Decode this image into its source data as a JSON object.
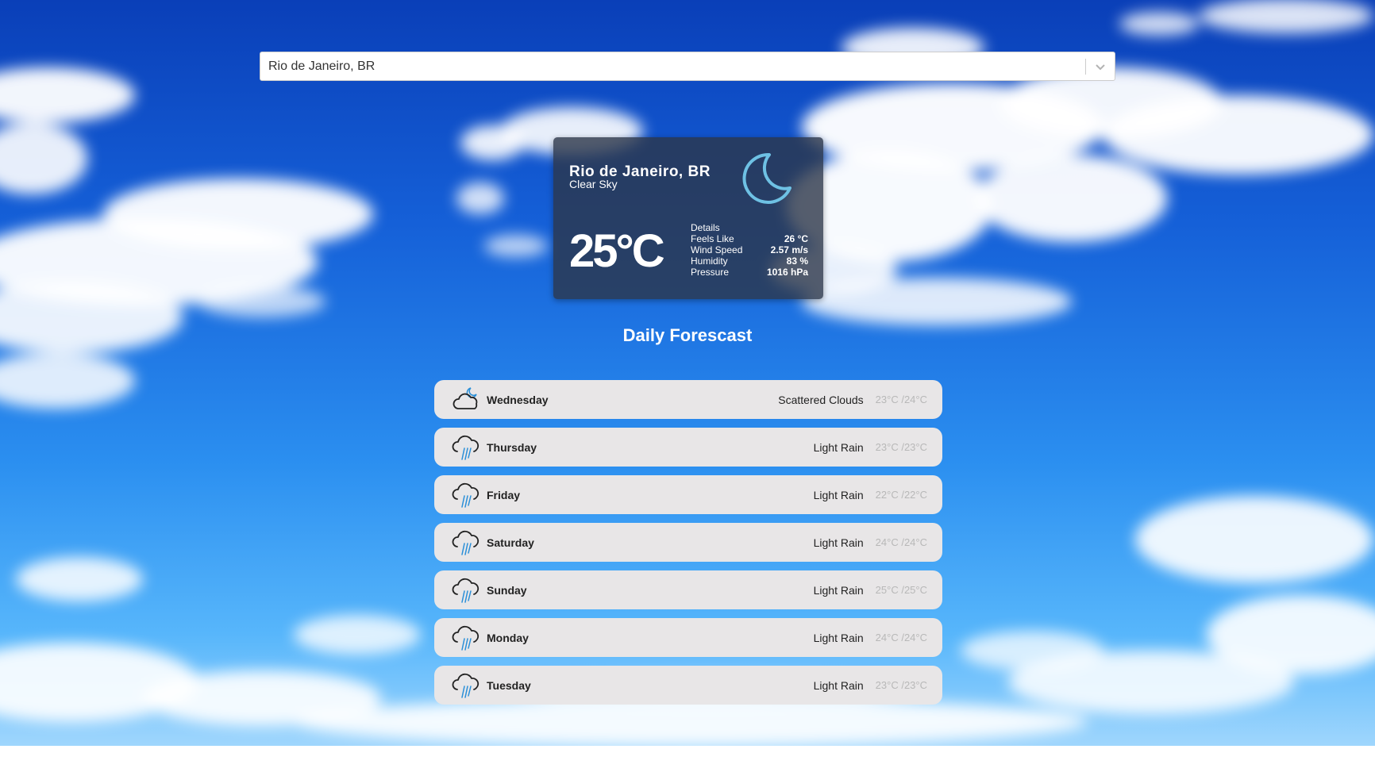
{
  "search": {
    "selected_value": "Rio de Janeiro, BR",
    "chevron_icon": "chevron-down-icon"
  },
  "current": {
    "city": "Rio de Janeiro, BR",
    "description": "Clear Sky",
    "icon": "moon-icon",
    "temperature": "25°C",
    "details_heading": "Details",
    "details": [
      {
        "label": "Feels Like",
        "value": "26 °C"
      },
      {
        "label": "Wind Speed",
        "value": "2.57 m/s"
      },
      {
        "label": "Humidity",
        "value": "83 %"
      },
      {
        "label": "Pressure",
        "value": "1016 hPa"
      }
    ]
  },
  "forecast": {
    "title": "Daily Forescast",
    "days": [
      {
        "day": "Wednesday",
        "condition": "Scattered Clouds",
        "range": "23°C /24°C",
        "icon": "cloud-moon-icon"
      },
      {
        "day": "Thursday",
        "condition": "Light Rain",
        "range": "23°C /23°C",
        "icon": "rain-icon"
      },
      {
        "day": "Friday",
        "condition": "Light Rain",
        "range": "22°C /22°C",
        "icon": "rain-icon"
      },
      {
        "day": "Saturday",
        "condition": "Light Rain",
        "range": "24°C /24°C",
        "icon": "rain-icon"
      },
      {
        "day": "Sunday",
        "condition": "Light Rain",
        "range": "25°C /25°C",
        "icon": "rain-icon"
      },
      {
        "day": "Monday",
        "condition": "Light Rain",
        "range": "24°C /24°C",
        "icon": "rain-icon"
      },
      {
        "day": "Tuesday",
        "condition": "Light Rain",
        "range": "23°C /23°C",
        "icon": "rain-icon"
      }
    ]
  },
  "colors": {
    "sky_top": "#0a3fb8",
    "sky_bottom": "#9fd6fd",
    "card_bg": "#2c3648",
    "row_bg": "#e8e6e7",
    "moon": "#6ec1e4",
    "rain": "#2a8fd8"
  }
}
